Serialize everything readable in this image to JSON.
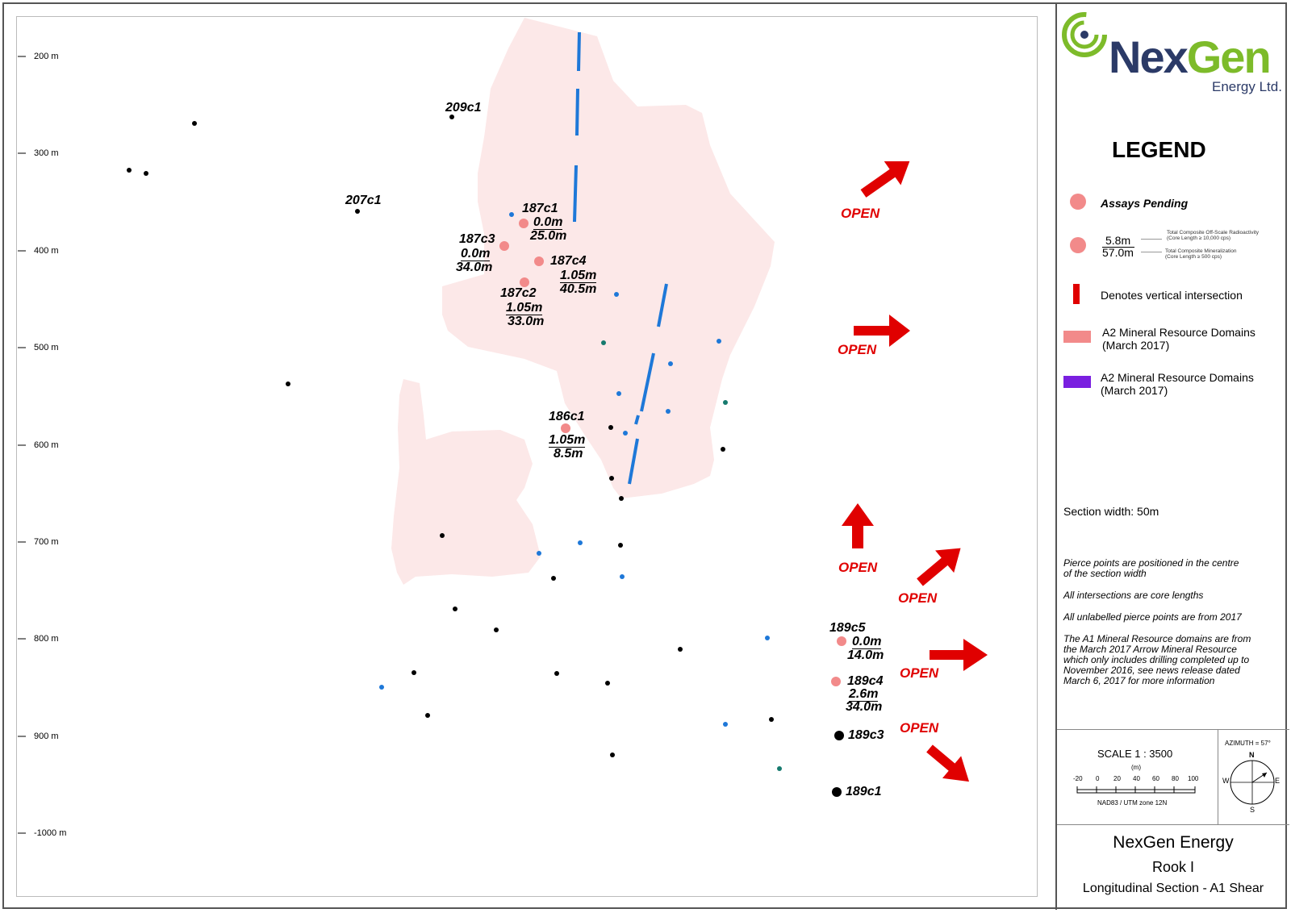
{
  "company": {
    "name_part1": "Nex",
    "name_part2": "Gen",
    "subtitle": "Energy Ltd."
  },
  "depth_axis": {
    "labels": [
      "200 m",
      "300 m",
      "400 m",
      "500 m",
      "600 m",
      "700 m",
      "800 m",
      "900 m",
      "-1000 m"
    ]
  },
  "drill_holes": [
    {
      "id": "209c1"
    },
    {
      "id": "207c1"
    },
    {
      "id": "187c1",
      "off_scale": "0.0m",
      "mineralization": "25.0m"
    },
    {
      "id": "187c3",
      "off_scale": "0.0m",
      "mineralization": "34.0m"
    },
    {
      "id": "187c4",
      "off_scale": "1.05m",
      "mineralization": "40.5m"
    },
    {
      "id": "187c2",
      "off_scale": "1.05m",
      "mineralization": "33.0m"
    },
    {
      "id": "186c1",
      "off_scale": "1.05m",
      "mineralization": "8.5m"
    },
    {
      "id": "189c5",
      "off_scale": "0.0m",
      "mineralization": "14.0m"
    },
    {
      "id": "189c4",
      "off_scale": "2.6m",
      "mineralization": "34.0m"
    },
    {
      "id": "189c3"
    },
    {
      "id": "189c1"
    }
  ],
  "open_label": "OPEN",
  "legend": {
    "title": "LEGEND",
    "assays_pending": "Assays Pending",
    "example_off_scale": "5.8m",
    "example_mineralization": "57.0m",
    "off_scale_note_1": "Total Composite Off-Scale Radioactivity",
    "off_scale_note_2": "(Core Length ≥ 10,000 cps)",
    "mineral_note_1": "Total Composite Mineralization",
    "mineral_note_2": "(Core Length ≥ 500 cps)",
    "vertical_intersection": "Denotes vertical intersection",
    "a2_domains_line1": "A2 Mineral Resource Domains",
    "a2_domains_line2": "(March 2017)",
    "a2_domains_b_line1": "A2 Mineral Resource Domains",
    "a2_domains_b_line2": "(March 2017)",
    "pink_color": "#f28a8a",
    "purple_color": "#7a1fe0",
    "red_color": "#e00000"
  },
  "section_width": "Section width: 50m",
  "notes": [
    "Pierce points are positioned in the centre",
    "of the section width",
    "All intersections are core lengths",
    "All unlabelled pierce points are from 2017",
    "The A1 Mineral Resource domains are from",
    "the March 2017 Arrow Mineral Resource",
    "which only includes drilling completed up to",
    "November 2016, see news release dated",
    "March 6, 2017 for more information"
  ],
  "scale": {
    "label": "SCALE  1 : 3500",
    "unit": "(m)",
    "ticks": [
      "-20",
      "0",
      "20",
      "40",
      "60",
      "80",
      "100"
    ],
    "datum": "NAD83 / UTM zone 12N"
  },
  "azimuth": {
    "label": "AZIMUTH = 57°",
    "n": "N",
    "s": "S",
    "e": "E",
    "w": "W"
  },
  "title_block": {
    "company": "NexGen Energy",
    "project": "Rook I",
    "section": "Longitudinal Section - A1 Shear"
  }
}
